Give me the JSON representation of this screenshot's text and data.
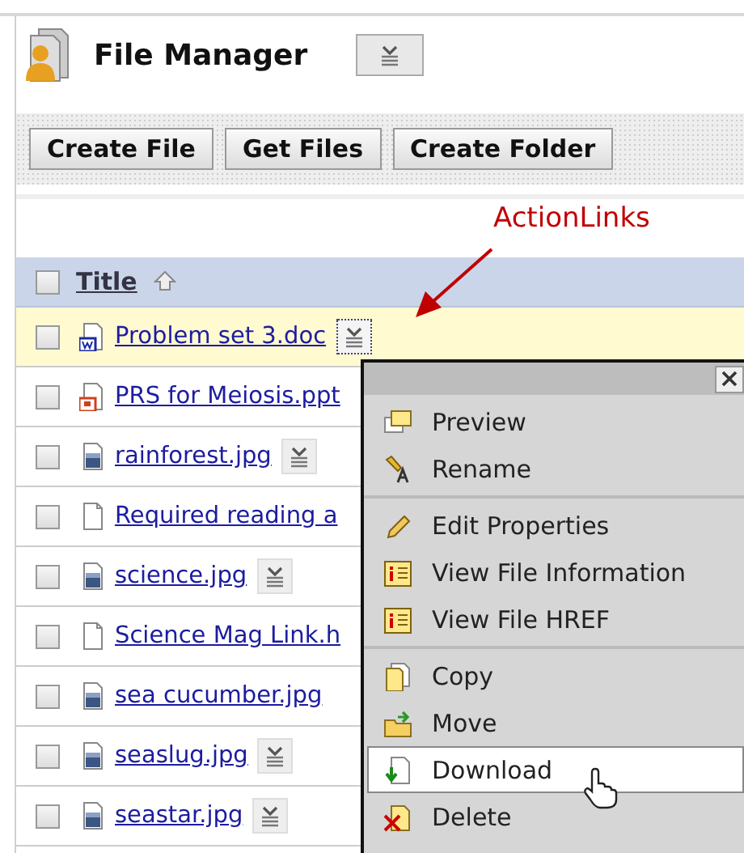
{
  "header": {
    "title": "File Manager"
  },
  "toolbar": {
    "buttons": [
      "Create File",
      "Get Files",
      "Create Folder"
    ]
  },
  "annotation": {
    "label": "ActionLinks"
  },
  "table": {
    "header": {
      "title": "Title",
      "checked": false
    },
    "rows": [
      {
        "name": "Problem set 3.doc",
        "kind": "doc",
        "checked": false,
        "highlighted": true,
        "action_button": true
      },
      {
        "name": "PRS for Meiosis.ppt",
        "kind": "ppt",
        "checked": false,
        "highlighted": false,
        "action_button": false
      },
      {
        "name": "rainforest.jpg",
        "kind": "image",
        "checked": false,
        "highlighted": false,
        "action_button": true
      },
      {
        "name": "Required reading a",
        "kind": "page",
        "checked": false,
        "highlighted": false,
        "action_button": false
      },
      {
        "name": "science.jpg",
        "kind": "image",
        "checked": false,
        "highlighted": false,
        "action_button": true
      },
      {
        "name": "Science Mag Link.h",
        "kind": "page",
        "checked": false,
        "highlighted": false,
        "action_button": false
      },
      {
        "name": "sea cucumber.jpg",
        "kind": "image",
        "checked": false,
        "highlighted": false,
        "action_button": false
      },
      {
        "name": "seaslug.jpg",
        "kind": "image",
        "checked": false,
        "highlighted": false,
        "action_button": true
      },
      {
        "name": "seastar.jpg",
        "kind": "image",
        "checked": false,
        "highlighted": false,
        "action_button": true
      }
    ]
  },
  "context_menu": {
    "groups": [
      [
        {
          "label": "Preview",
          "selected": false
        },
        {
          "label": "Rename",
          "selected": false
        }
      ],
      [
        {
          "label": "Edit Properties",
          "selected": false
        },
        {
          "label": "View File Information",
          "selected": false
        },
        {
          "label": "View File HREF",
          "selected": false
        }
      ],
      [
        {
          "label": "Copy",
          "selected": false
        },
        {
          "label": "Move",
          "selected": false
        },
        {
          "label": "Download",
          "selected": true
        },
        {
          "label": "Delete",
          "selected": false
        }
      ]
    ]
  }
}
